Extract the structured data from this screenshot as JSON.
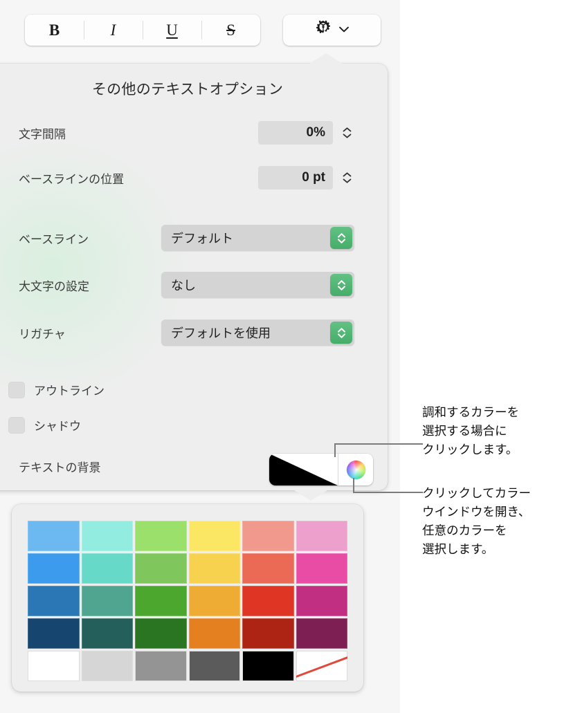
{
  "toolbar": {
    "format_buttons": [
      {
        "name": "bold",
        "label": "B"
      },
      {
        "name": "italic",
        "label": "I"
      },
      {
        "name": "underline",
        "label": "U"
      },
      {
        "name": "strikethrough",
        "label": "S"
      }
    ],
    "gear_button": {
      "icon": "gear-icon",
      "chevron": "chevron-down-icon"
    }
  },
  "options_popover": {
    "title": "その他のテキストオプション",
    "numeric_rows": [
      {
        "label": "文字間隔",
        "value": "0%"
      },
      {
        "label": "ベースラインの位置",
        "value": "0 pt"
      }
    ],
    "select_rows": [
      {
        "label": "ベースライン",
        "value": "デフォルト"
      },
      {
        "label": "大文字の設定",
        "value": "なし"
      },
      {
        "label": "リガチャ",
        "value": "デフォルトを使用"
      }
    ],
    "checkbox_rows": [
      {
        "label": "アウトライン",
        "checked": false
      },
      {
        "label": "シャドウ",
        "checked": false
      }
    ],
    "text_background": {
      "label": "テキストの背景",
      "swatch_colors": [
        "#000000",
        "#ffffff"
      ],
      "wheel_button": "color-wheel-icon"
    }
  },
  "palette_popover": {
    "columns": 6,
    "rows": 5,
    "colors": [
      [
        "#6cb8f0",
        "#92ede0",
        "#9be06a",
        "#fbe764",
        "#f0998c",
        "#eea0cd"
      ],
      [
        "#3d9bee",
        "#66d9c8",
        "#7fc75c",
        "#f7d24f",
        "#ea6a56",
        "#e84ca5"
      ],
      [
        "#2b77b5",
        "#4fa58f",
        "#4ca72f",
        "#eeac35",
        "#df3524",
        "#c12f83"
      ],
      [
        "#16456f",
        "#245f5b",
        "#2a7521",
        "#e4801f",
        "#ad2414",
        "#7d1f52"
      ],
      [
        "#ffffff",
        "#d6d6d6",
        "#949494",
        "#5b5b5b",
        "#000000",
        "none"
      ]
    ],
    "no_color_label": "なし"
  },
  "callouts": [
    {
      "text": "調和するカラーを\n選択する場合に\nクリックします。"
    },
    {
      "text": "クリックしてカラー\nウインドウを開き、\n任意のカラーを\n選択します。"
    }
  ],
  "theme": {
    "popover_bg": "#eeeeee",
    "canvas_bg": "#f6f6f6",
    "stepper_green": "#4cb172",
    "field_gray": "#d4d4d4",
    "lead_gray": "#7b7b7b"
  }
}
